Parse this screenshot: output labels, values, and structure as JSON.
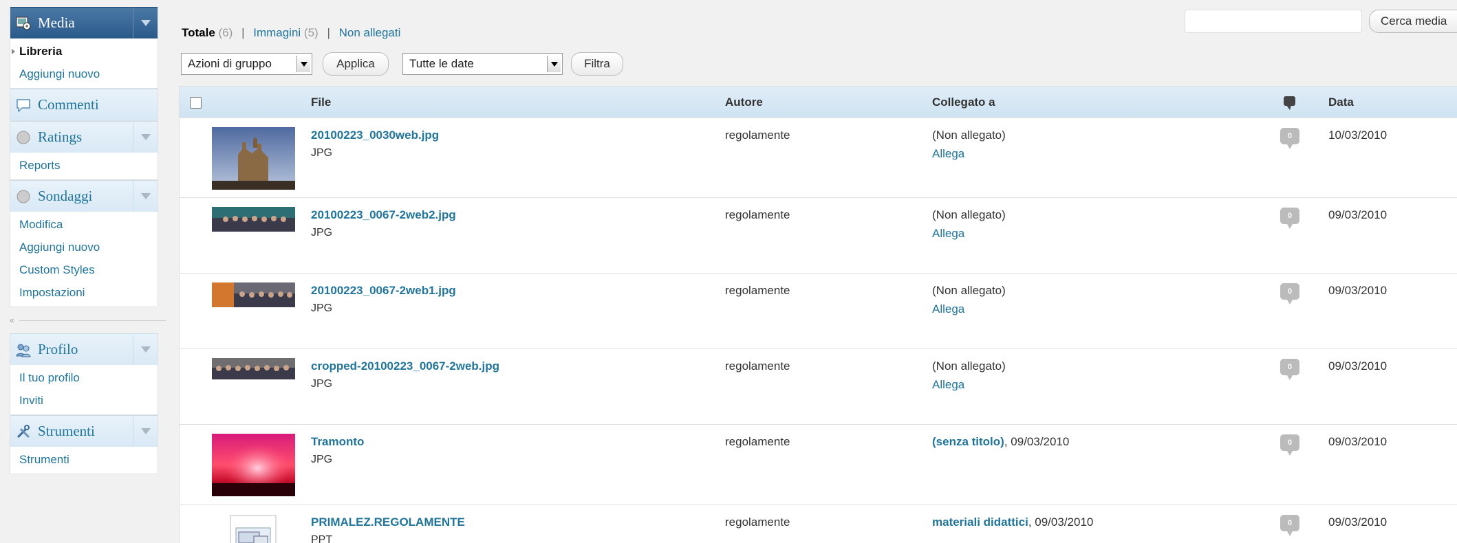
{
  "sidebar": {
    "media": {
      "title": "Media",
      "items": [
        "Libreria",
        "Aggiungi nuovo"
      ]
    },
    "comments": {
      "title": "Commenti"
    },
    "ratings": {
      "title": "Ratings",
      "items": [
        "Reports"
      ]
    },
    "polls": {
      "title": "Sondaggi",
      "items": [
        "Modifica",
        "Aggiungi nuovo",
        "Custom Styles",
        "Impostazioni"
      ]
    },
    "collapse_glyph": "«",
    "profile": {
      "title": "Profilo",
      "items": [
        "Il tuo profilo",
        "Inviti"
      ]
    },
    "tools": {
      "title": "Strumenti",
      "items": [
        "Strumenti"
      ]
    }
  },
  "filters": {
    "total_label": "Totale",
    "total_count": "(6)",
    "images_label": "Immagini",
    "images_count": "(5)",
    "unattached_label": "Non allegati",
    "separator": "|"
  },
  "search": {
    "value": "",
    "button": "Cerca media"
  },
  "toolbar": {
    "bulk_select": "Azioni di gruppo",
    "apply": "Applica",
    "date_select": "Tutte le date",
    "filter": "Filtra"
  },
  "table": {
    "columns": {
      "file": "File",
      "author": "Autore",
      "attached": "Collegato a",
      "date": "Data"
    },
    "rows": [
      {
        "name": "20100223_0030web.jpg",
        "type": "JPG",
        "author": "regolamente",
        "attached_title": "(Non allegato)",
        "attached_rest": "",
        "attach_link": "Allega",
        "comments": "0",
        "date": "10/03/2010",
        "thumb": "cathedral"
      },
      {
        "name": "20100223_0067-2web2.jpg",
        "type": "JPG",
        "author": "regolamente",
        "attached_title": "(Non allegato)",
        "attached_rest": "",
        "attach_link": "Allega",
        "comments": "0",
        "date": "09/03/2010",
        "thumb": "group-teal"
      },
      {
        "name": "20100223_0067-2web1.jpg",
        "type": "JPG",
        "author": "regolamente",
        "attached_title": "(Non allegato)",
        "attached_rest": "",
        "attach_link": "Allega",
        "comments": "0",
        "date": "09/03/2010",
        "thumb": "group-orange"
      },
      {
        "name": "cropped-20100223_0067-2web.jpg",
        "type": "JPG",
        "author": "regolamente",
        "attached_title": "(Non allegato)",
        "attached_rest": "",
        "attach_link": "Allega",
        "comments": "0",
        "date": "09/03/2010",
        "thumb": "group-wide"
      },
      {
        "name": "Tramonto",
        "type": "JPG",
        "author": "regolamente",
        "attached_title": "(senza titolo)",
        "attached_rest": ", 09/03/2010",
        "attach_link": "",
        "comments": "0",
        "date": "09/03/2010",
        "thumb": "sunset"
      },
      {
        "name": "PRIMALEZ.REGOLAMENTE",
        "type": "PPT",
        "author": "regolamente",
        "attached_title": "materiali didattici",
        "attached_rest": ", 09/03/2010",
        "attach_link": "",
        "comments": "0",
        "date": "09/03/2010",
        "thumb": "document"
      }
    ]
  }
}
